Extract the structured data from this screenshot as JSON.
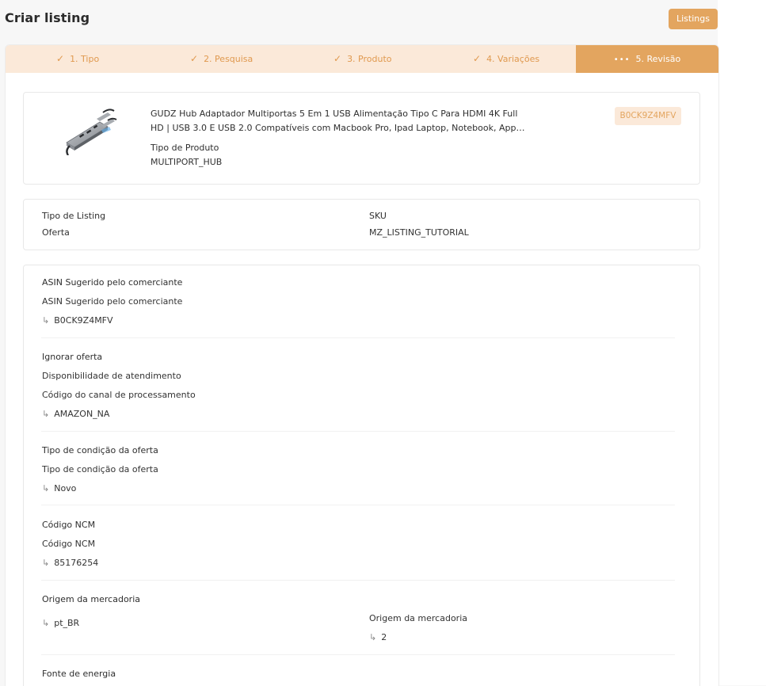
{
  "header": {
    "title": "Criar listing",
    "listings_button": "Listings"
  },
  "steps": [
    {
      "label": "1. Tipo",
      "status": "done"
    },
    {
      "label": "2. Pesquisa",
      "status": "done"
    },
    {
      "label": "3. Produto",
      "status": "done"
    },
    {
      "label": "4. Variações",
      "status": "done"
    },
    {
      "label": "5. Revisão",
      "status": "active"
    }
  ],
  "icons": {
    "check": "check-icon",
    "dots": "more-dots-icon",
    "arrow": "return-arrow-icon"
  },
  "colors": {
    "accent": "#e3a55f",
    "accent_light": "#fbe9d9"
  },
  "product": {
    "title_line1": "GUDZ Hub Adaptador Multiportas 5 Em 1 USB Alimentação Tipo C Para HDMI 4K Full",
    "title_line2": "HD | USB 3.0 E USB 2.0 Compatíveis com Macbook Pro, Ipad Laptop, Notebook, App…",
    "type_label": "Tipo de Produto",
    "type_value": "MULTIPORT_HUB",
    "asin_badge": "B0CK9Z4MFV"
  },
  "listing": {
    "type_label": "Tipo de Listing",
    "type_value": "Oferta",
    "sku_label": "SKU",
    "sku_value": "MZ_LISTING_TUTORIAL"
  },
  "attributes": {
    "asin_section": "ASIN Sugerido pelo comerciante",
    "asin_field": "ASIN Sugerido pelo comerciante",
    "asin_value": "B0CK9Z4MFV",
    "ignore_offer": "Ignorar oferta",
    "fulfillment": "Disponibilidade de atendimento",
    "channel_code": "Código do canal de processamento",
    "channel_value": "AMAZON_NA",
    "condition_section": "Tipo de condição da oferta",
    "condition_field": "Tipo de condição da oferta",
    "condition_value": "Novo",
    "ncm_section": "Código NCM",
    "ncm_field": "Código NCM",
    "ncm_value": "85176254",
    "origin_section": "Origem da mercadoria",
    "origin_locale": "pt_BR",
    "origin_field": "Origem da mercadoria",
    "origin_value": "2",
    "power_section": "Fonte de energia"
  }
}
